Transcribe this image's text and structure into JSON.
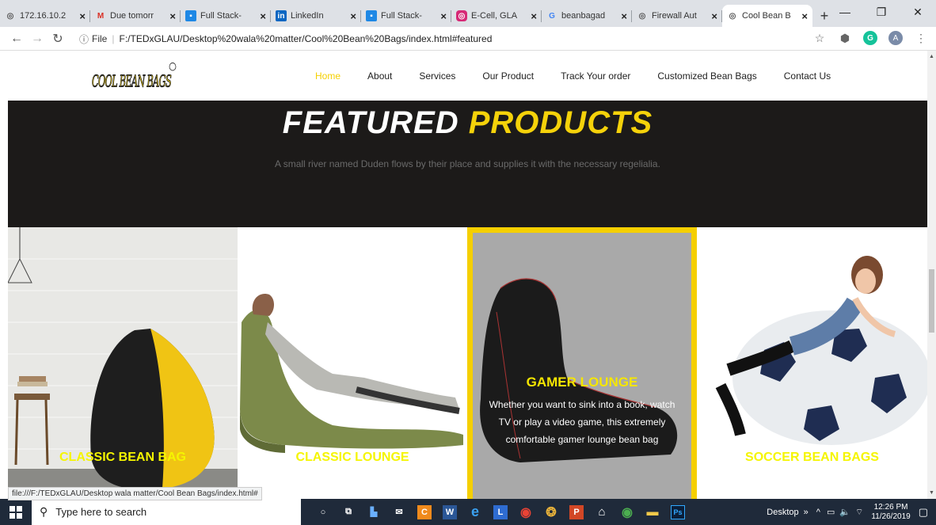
{
  "browser": {
    "tabs": [
      {
        "title": "172.16.10.2",
        "icon": "globe-icon",
        "active": false
      },
      {
        "title": "Due tomorr",
        "icon": "gmail-icon",
        "active": false
      },
      {
        "title": "Full Stack-",
        "icon": "classroom-icon",
        "active": false
      },
      {
        "title": "LinkedIn",
        "icon": "linkedin-icon",
        "active": false
      },
      {
        "title": "Full Stack-",
        "icon": "classroom-icon",
        "active": false
      },
      {
        "title": "E-Cell, GLA",
        "icon": "instagram-icon",
        "active": false
      },
      {
        "title": "beanbagad",
        "icon": "google-icon",
        "active": false
      },
      {
        "title": "Firewall Aut",
        "icon": "globe-icon",
        "active": false
      },
      {
        "title": "Cool Bean B",
        "icon": "globe-icon",
        "active": true
      }
    ],
    "new_tab": "+",
    "address": {
      "info": "ⓘ",
      "scheme_label": "File",
      "url": "F:/TEDxGLAU/Desktop%20wala%20matter/Cool%20Bean%20Bags/index.html#featured"
    },
    "avatar_letter": "A",
    "status_url": "file:///F:/TEDxGLAU/Desktop wala matter/Cool Bean Bags/index.html#"
  },
  "site": {
    "logo_text": "COOL BEAN BAGS",
    "logo_reg": "®",
    "menu": [
      {
        "label": "Home",
        "active": true
      },
      {
        "label": "About",
        "active": false
      },
      {
        "label": "Services",
        "active": false
      },
      {
        "label": "Our Product",
        "active": false
      },
      {
        "label": "Track Your order",
        "active": false
      },
      {
        "label": "Customized Bean Bags",
        "active": false
      },
      {
        "label": "Contact Us",
        "active": false
      }
    ],
    "featured": {
      "title_white": "FEATURED",
      "title_yellow": "PRODUCTS",
      "subtitle": "A small river named Duden flows by their place and supplies it with the necessary regelialia."
    },
    "products": [
      {
        "name": "CLASSIC BEAN BAG"
      },
      {
        "name": "CLASSIC LOUNGE"
      },
      {
        "name": "GAMER LOUNGE",
        "description": "Whether you want to sink into a book, watch TV or play a video game, this extremely comfortable gamer lounge bean bag"
      },
      {
        "name": "SOCCER BEAN BAGS"
      }
    ]
  },
  "taskbar": {
    "search_placeholder": "Type here to search",
    "desktop_label": "Desktop",
    "time": "12:26 PM",
    "date": "11/26/2019"
  },
  "colors": {
    "accent_yellow": "#f5d20a",
    "dark_band": "#1c1a19",
    "taskbar": "#1f2a3a"
  }
}
